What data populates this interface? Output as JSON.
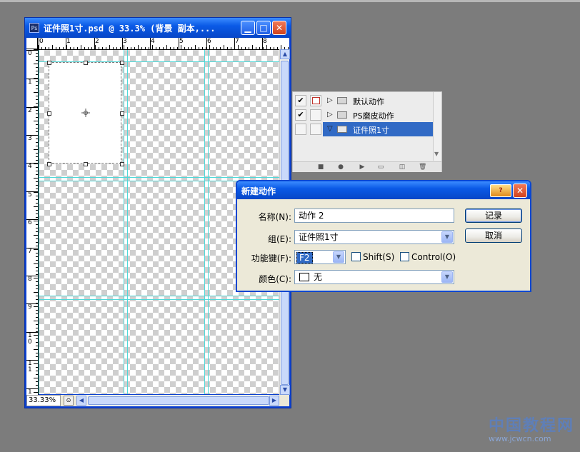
{
  "document": {
    "title": "证件照1寸.psd @ 33.3% (背景 副本,...",
    "app_icon": "Ps",
    "zoom": "33.33%",
    "ruler_h": [
      "0",
      "1",
      "2",
      "3",
      "4",
      "5",
      "6",
      "7",
      "8"
    ],
    "ruler_v": [
      "0",
      "1",
      "2",
      "3",
      "4",
      "5",
      "6",
      "7",
      "8",
      "9",
      "10",
      "11",
      "1"
    ]
  },
  "actions_panel": {
    "items": [
      {
        "label": "默认动作",
        "checked": true,
        "dialog": true,
        "expanded": false,
        "selected": false
      },
      {
        "label": "PS磨皮动作",
        "checked": true,
        "dialog": false,
        "expanded": false,
        "selected": false
      },
      {
        "label": "证件照1寸",
        "checked": false,
        "dialog": false,
        "expanded": true,
        "selected": true
      }
    ],
    "toolbar_icons": [
      "stop-icon",
      "record-icon",
      "play-icon",
      "new-set-icon",
      "new-action-icon",
      "trash-icon"
    ]
  },
  "dialog": {
    "title": "新建动作",
    "name_label": "名称(N):",
    "name_value": "动作 2",
    "set_label": "组(E):",
    "set_value": "证件照1寸",
    "hotkey_label": "功能键(F):",
    "hotkey_value": "F2",
    "shift_label": "Shift(S)",
    "control_label": "Control(O)",
    "color_label": "颜色(C):",
    "color_value": "无",
    "record_button": "记录",
    "cancel_button": "取消"
  },
  "watermark": {
    "main": "中国教程网",
    "sub": "www.jcwcn.com"
  },
  "colors": {
    "title_bar": "#0a5ae6",
    "guide": "#4fd8d8",
    "selection_highlight": "#316ac5",
    "background": "#7c7c7c"
  }
}
